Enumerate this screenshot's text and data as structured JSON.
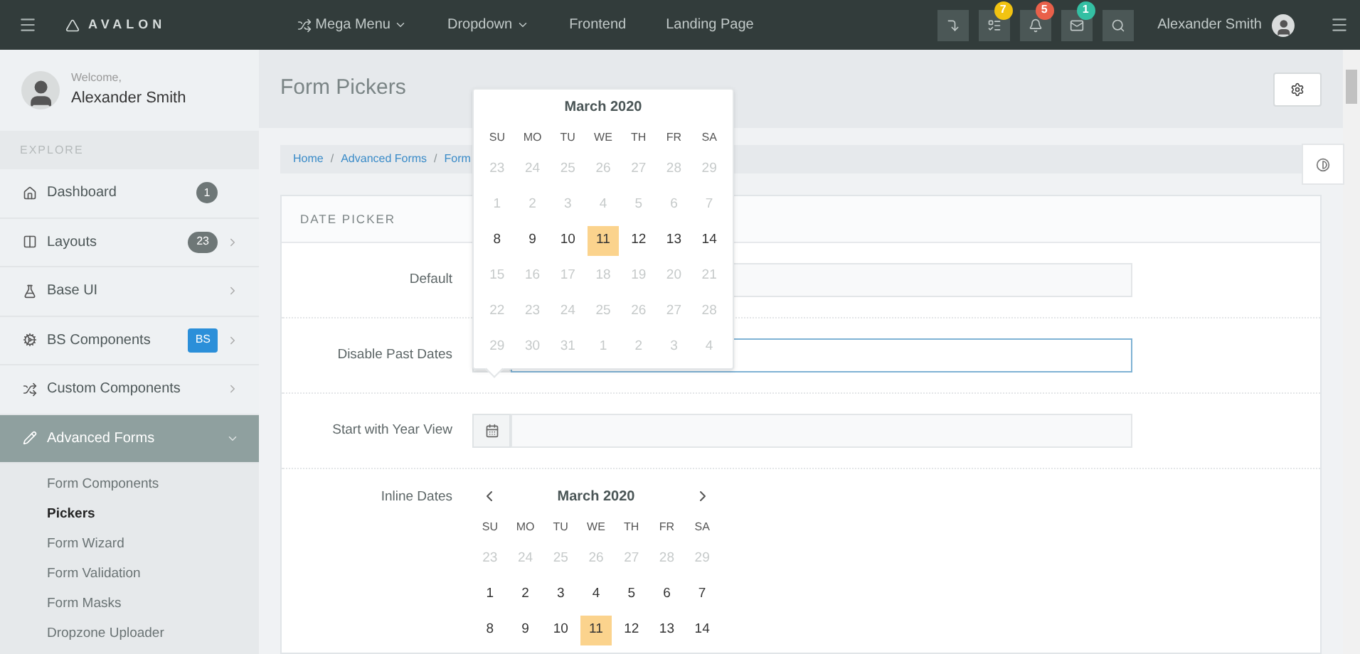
{
  "header": {
    "brand": "AVALON",
    "nav": [
      {
        "label": "Mega Menu",
        "dropdown": true,
        "kind": "shuffle"
      },
      {
        "label": "Dropdown",
        "dropdown": true
      },
      {
        "label": "Frontend",
        "dropdown": false
      },
      {
        "label": "Landing Page",
        "dropdown": false
      }
    ],
    "tools": [
      {
        "kind": "exit"
      },
      {
        "kind": "tasks",
        "badge": "7",
        "color": "#f2c311"
      },
      {
        "kind": "alerts",
        "badge": "5",
        "color": "#e9604a"
      },
      {
        "kind": "messages",
        "badge": "1",
        "color": "#34bfa3"
      },
      {
        "kind": "search"
      }
    ],
    "user": "Alexander Smith"
  },
  "sidebar": {
    "welcome": "Welcome,",
    "user": "Alexander Smith",
    "section": "EXPLORE",
    "items": [
      {
        "kind": "home",
        "label": "Dashboard",
        "badge": {
          "text": "1",
          "kind": "circle",
          "color": "#6e7777"
        },
        "selected": false
      },
      {
        "kind": "columns",
        "label": "Layouts",
        "badge": {
          "text": "23",
          "kind": "pill",
          "color": "#6e7777"
        },
        "selected": false,
        "expanded": false
      },
      {
        "kind": "flask",
        "label": "Base UI",
        "selected": false,
        "expanded": false
      },
      {
        "kind": "cogs",
        "label": "BS Components",
        "badge": {
          "text": "BS",
          "kind": "square",
          "color": "#2b8fd9"
        },
        "selected": false,
        "expanded": false
      },
      {
        "kind": "shuffle",
        "label": "Custom Components",
        "selected": false,
        "expanded": false
      },
      {
        "kind": "pencil",
        "label": "Advanced Forms",
        "selected": true,
        "expanded": true,
        "children": [
          {
            "label": "Form Components",
            "selected": false
          },
          {
            "label": "Pickers",
            "selected": true
          },
          {
            "label": "Form Wizard",
            "selected": false
          },
          {
            "label": "Form Validation",
            "selected": false
          },
          {
            "label": "Form Masks",
            "selected": false
          },
          {
            "label": "Dropzone Uploader",
            "selected": false
          }
        ]
      }
    ]
  },
  "page": {
    "title": "Form Pickers",
    "breadcrumb": [
      "Home",
      "Advanced Forms",
      "Form"
    ],
    "breadcrumb_separator": "/"
  },
  "card": {
    "title": "DATE PICKER",
    "rows": [
      {
        "kind": "input",
        "label": "Default",
        "focused": false
      },
      {
        "kind": "input",
        "label": "Disable Past Dates",
        "focused": true
      },
      {
        "kind": "input",
        "label": "Start with Year View",
        "focused": false
      },
      {
        "kind": "inline",
        "label": "Inline Dates"
      }
    ]
  },
  "popup_calendar": {
    "title": "March 2020",
    "weekdays": [
      "SU",
      "MO",
      "TU",
      "WE",
      "TH",
      "FR",
      "SA"
    ],
    "weeks": [
      [
        {
          "d": "23",
          "muted": true,
          "selected": false
        },
        {
          "d": "24",
          "muted": true,
          "selected": false
        },
        {
          "d": "25",
          "muted": true,
          "selected": false
        },
        {
          "d": "26",
          "muted": true,
          "selected": false
        },
        {
          "d": "27",
          "muted": true,
          "selected": false
        },
        {
          "d": "28",
          "muted": true,
          "selected": false
        },
        {
          "d": "29",
          "muted": true,
          "selected": false
        }
      ],
      [
        {
          "d": "1",
          "muted": true,
          "selected": false
        },
        {
          "d": "2",
          "muted": true,
          "selected": false
        },
        {
          "d": "3",
          "muted": true,
          "selected": false
        },
        {
          "d": "4",
          "muted": true,
          "selected": false
        },
        {
          "d": "5",
          "muted": true,
          "selected": false
        },
        {
          "d": "6",
          "muted": true,
          "selected": false
        },
        {
          "d": "7",
          "muted": true,
          "selected": false
        }
      ],
      [
        {
          "d": "8",
          "muted": false,
          "selected": false
        },
        {
          "d": "9",
          "muted": false,
          "selected": false
        },
        {
          "d": "10",
          "muted": false,
          "selected": false
        },
        {
          "d": "11",
          "muted": false,
          "selected": true
        },
        {
          "d": "12",
          "muted": false,
          "selected": false
        },
        {
          "d": "13",
          "muted": false,
          "selected": false
        },
        {
          "d": "14",
          "muted": false,
          "selected": false
        }
      ],
      [
        {
          "d": "15",
          "muted": true,
          "selected": false
        },
        {
          "d": "16",
          "muted": true,
          "selected": false
        },
        {
          "d": "17",
          "muted": true,
          "selected": false
        },
        {
          "d": "18",
          "muted": true,
          "selected": false
        },
        {
          "d": "19",
          "muted": true,
          "selected": false
        },
        {
          "d": "20",
          "muted": true,
          "selected": false
        },
        {
          "d": "21",
          "muted": true,
          "selected": false
        }
      ],
      [
        {
          "d": "22",
          "muted": true,
          "selected": false
        },
        {
          "d": "23",
          "muted": true,
          "selected": false
        },
        {
          "d": "24",
          "muted": true,
          "selected": false
        },
        {
          "d": "25",
          "muted": true,
          "selected": false
        },
        {
          "d": "26",
          "muted": true,
          "selected": false
        },
        {
          "d": "27",
          "muted": true,
          "selected": false
        },
        {
          "d": "28",
          "muted": true,
          "selected": false
        }
      ],
      [
        {
          "d": "29",
          "muted": true,
          "selected": false
        },
        {
          "d": "30",
          "muted": true,
          "selected": false
        },
        {
          "d": "31",
          "muted": true,
          "selected": false
        },
        {
          "d": "1",
          "muted": true,
          "selected": false
        },
        {
          "d": "2",
          "muted": true,
          "selected": false
        },
        {
          "d": "3",
          "muted": true,
          "selected": false
        },
        {
          "d": "4",
          "muted": true,
          "selected": false
        }
      ]
    ]
  },
  "inline_calendar": {
    "title": "March 2020",
    "weekdays": [
      "SU",
      "MO",
      "TU",
      "WE",
      "TH",
      "FR",
      "SA"
    ],
    "weeks": [
      [
        {
          "d": "23",
          "muted": true,
          "selected": false
        },
        {
          "d": "24",
          "muted": true,
          "selected": false
        },
        {
          "d": "25",
          "muted": true,
          "selected": false
        },
        {
          "d": "26",
          "muted": true,
          "selected": false
        },
        {
          "d": "27",
          "muted": true,
          "selected": false
        },
        {
          "d": "28",
          "muted": true,
          "selected": false
        },
        {
          "d": "29",
          "muted": true,
          "selected": false
        }
      ],
      [
        {
          "d": "1",
          "muted": false,
          "selected": false
        },
        {
          "d": "2",
          "muted": false,
          "selected": false
        },
        {
          "d": "3",
          "muted": false,
          "selected": false
        },
        {
          "d": "4",
          "muted": false,
          "selected": false
        },
        {
          "d": "5",
          "muted": false,
          "selected": false
        },
        {
          "d": "6",
          "muted": false,
          "selected": false
        },
        {
          "d": "7",
          "muted": false,
          "selected": false
        }
      ],
      [
        {
          "d": "8",
          "muted": false,
          "selected": false
        },
        {
          "d": "9",
          "muted": false,
          "selected": false
        },
        {
          "d": "10",
          "muted": false,
          "selected": false
        },
        {
          "d": "11",
          "muted": false,
          "selected": true
        },
        {
          "d": "12",
          "muted": false,
          "selected": false
        },
        {
          "d": "13",
          "muted": false,
          "selected": false
        },
        {
          "d": "14",
          "muted": false,
          "selected": false
        }
      ]
    ]
  }
}
